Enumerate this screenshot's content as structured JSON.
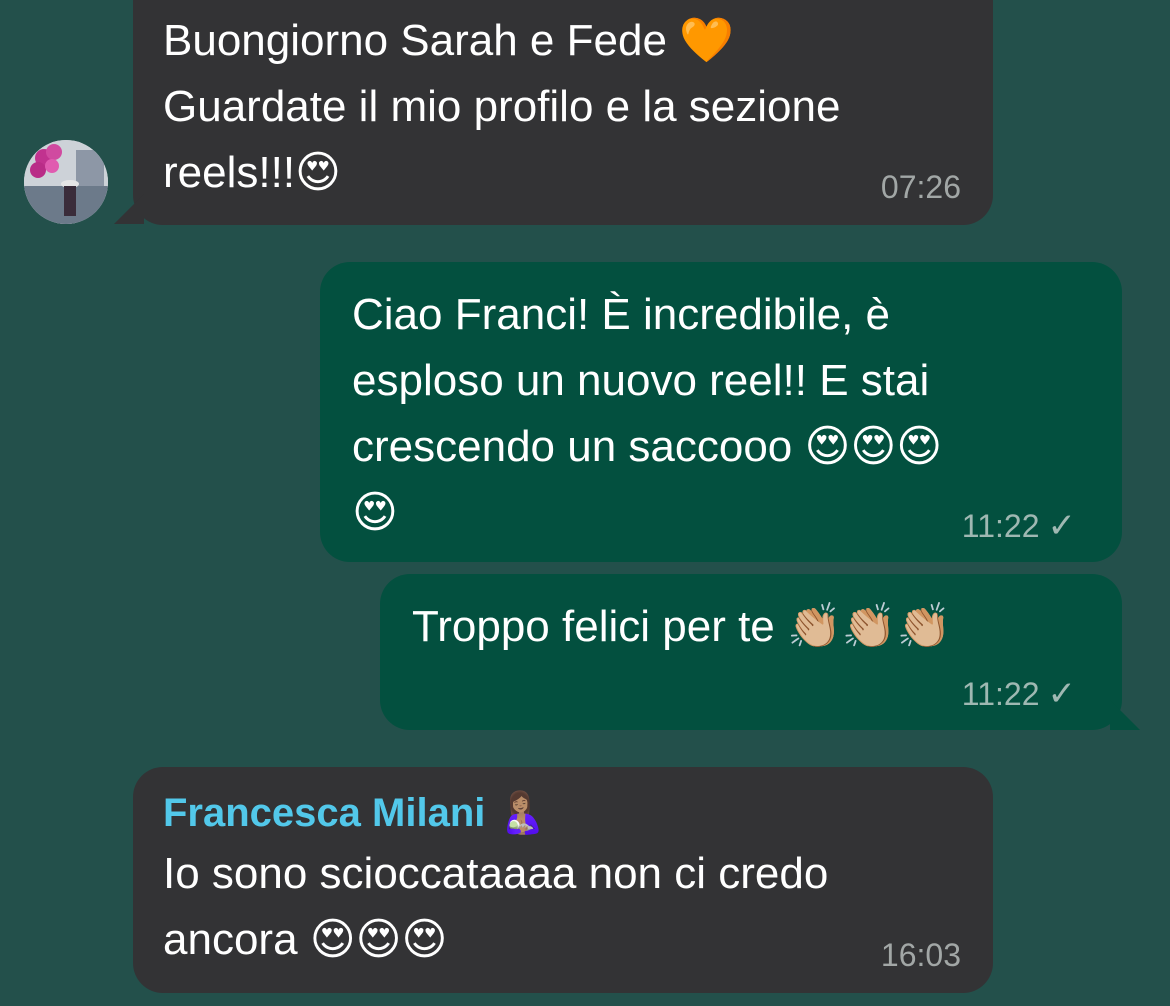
{
  "colors": {
    "background": "#23504b",
    "incoming_bubble": "#333335",
    "outgoing_bubble": "#03503f",
    "sender_name": "#52c8ea"
  },
  "messages": [
    {
      "direction": "incoming",
      "text": "Buongiorno Sarah e Fede 🧡\nGuardate il mio profilo e la sezione\nreels!!!😍",
      "time": "07:26"
    },
    {
      "direction": "outgoing",
      "text": "Ciao Franci! È incredibile, è\nesploso un nuovo reel!! E stai\ncrescendo un saccooo 😍😍😍\n😍",
      "time": "11:22",
      "status_icon": "single-check-icon"
    },
    {
      "direction": "outgoing",
      "text": "Troppo felici per te 👏🏼👏🏼👏🏼",
      "time": "11:22",
      "status_icon": "single-check-icon"
    },
    {
      "direction": "incoming",
      "sender": "Francesca Milani 🤱🏽",
      "text": "Io sono scioccataaaa non ci credo\nancora 😍😍😍",
      "time": "16:03"
    }
  ]
}
